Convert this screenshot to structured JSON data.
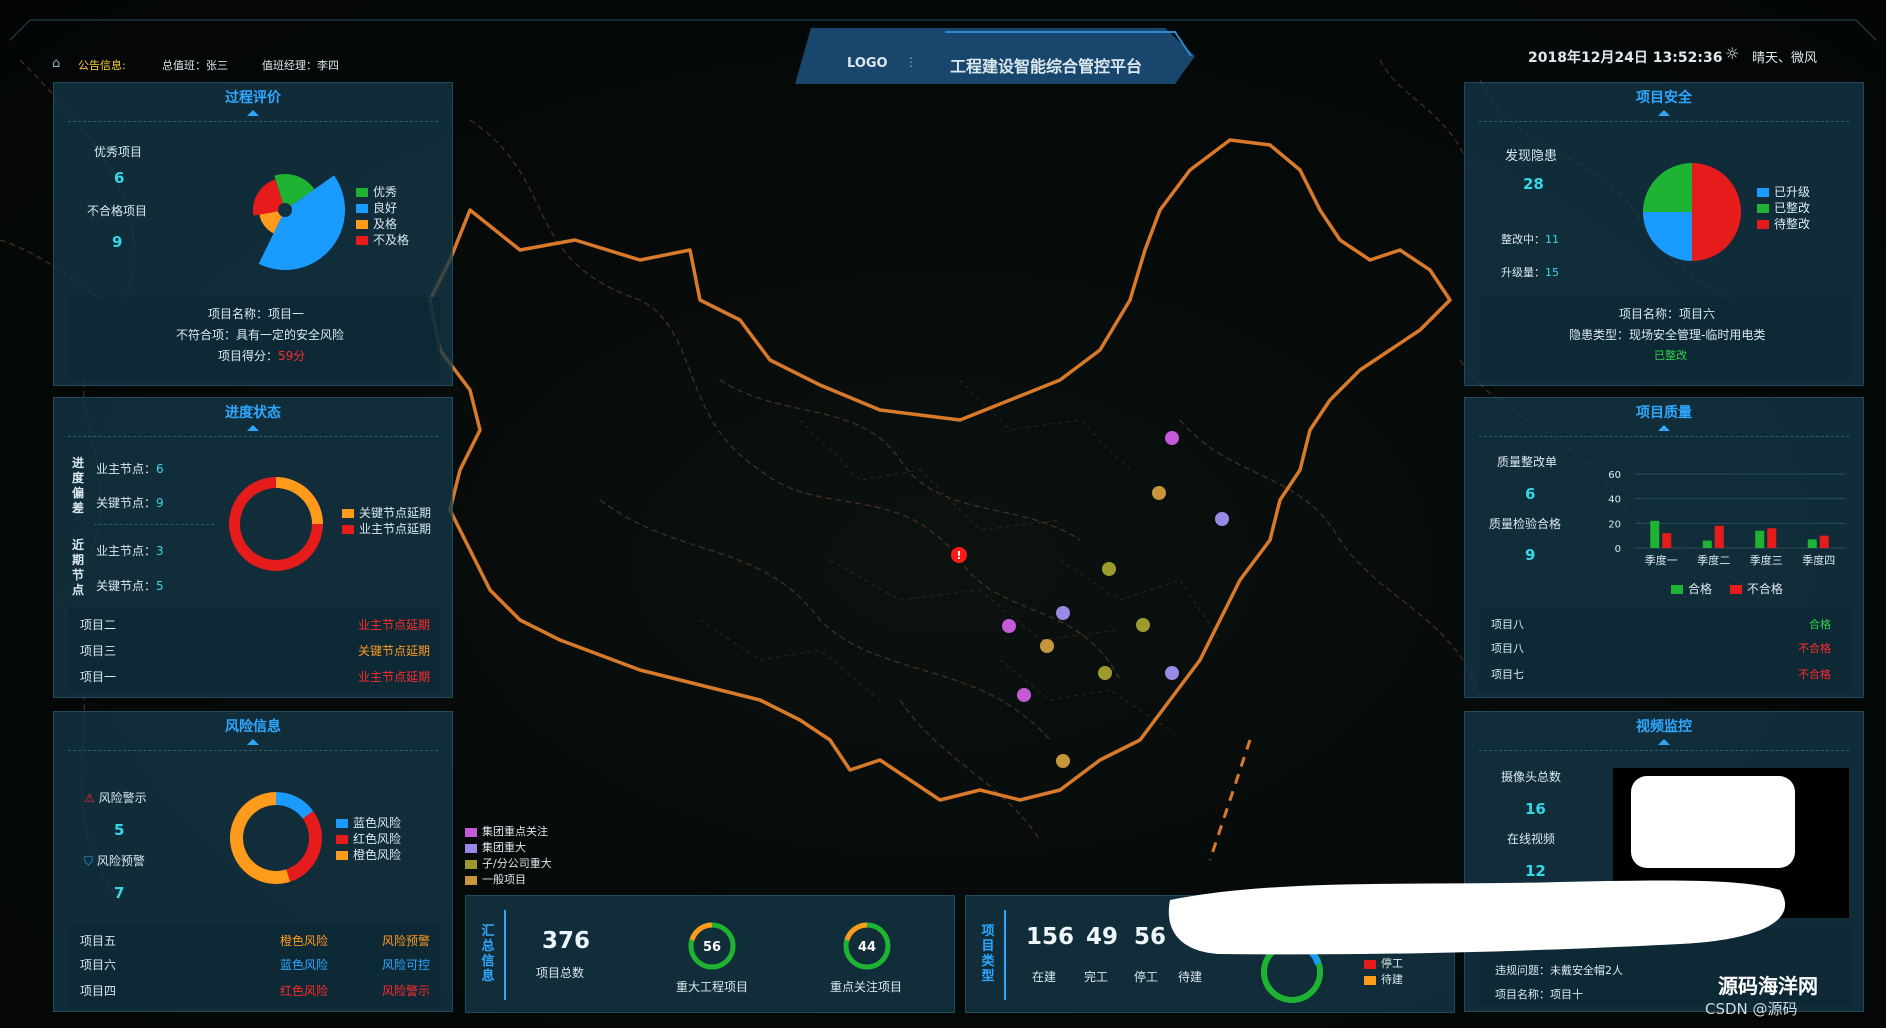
{
  "header": {
    "notice_label": "公告信息:",
    "chief_duty": "总值班：张三",
    "duty_manager": "值班经理：李四",
    "logo": "LOGO",
    "title": "工程建设智能综合管控平台",
    "datetime": "2018年12月24日 13:52:36",
    "weather": "晴天、微风"
  },
  "process_eval": {
    "title": "过程评价",
    "excellent_label": "优秀项目",
    "excellent_value": "6",
    "fail_label": "不合格项目",
    "fail_value": "9",
    "legend": [
      {
        "name": "优秀",
        "color": "#1eb332"
      },
      {
        "name": "良好",
        "color": "#1a9bff"
      },
      {
        "name": "及格",
        "color": "#ff9b1c"
      },
      {
        "name": "不及格",
        "color": "#e61c1c"
      }
    ],
    "project_name": "项目名称：项目一",
    "nonconform": "不符合项：具有一定的安全风险",
    "score_label": "项目得分：",
    "score_value": "59分"
  },
  "progress": {
    "title": "进度状态",
    "group1_label": "进度偏差",
    "group2_label": "近期节点",
    "g1_owner_label": "业主节点：",
    "g1_owner_value": "6",
    "g1_key_label": "关键节点：",
    "g1_key_value": "9",
    "g2_owner_label": "业主节点：",
    "g2_owner_value": "3",
    "g2_key_label": "关键节点：",
    "g2_key_value": "5",
    "legend": [
      {
        "name": "关键节点延期",
        "color": "#ff9b1c"
      },
      {
        "name": "业主节点延期",
        "color": "#e61c1c"
      }
    ],
    "rows": [
      {
        "name": "项目二",
        "status": "业主节点延期",
        "color": "#ff2a2a"
      },
      {
        "name": "项目三",
        "status": "关键节点延期",
        "color": "#ff9a1f"
      },
      {
        "name": "项目一",
        "status": "业主节点延期",
        "color": "#ff2a2a"
      }
    ]
  },
  "risk": {
    "title": "风险信息",
    "warning_label": "风险警示",
    "warning_value": "5",
    "alert_label": "风险预警",
    "alert_value": "7",
    "legend": [
      {
        "name": "蓝色风险",
        "color": "#1a9bff"
      },
      {
        "name": "红色风险",
        "color": "#e61c1c"
      },
      {
        "name": "橙色风险",
        "color": "#ff9b1c"
      }
    ],
    "rows": [
      {
        "name": "项目五",
        "level": "橙色风险",
        "level_color": "#ff9a1f",
        "type": "风险预警",
        "type_color": "#ff9a1f"
      },
      {
        "name": "项目六",
        "level": "蓝色风险",
        "level_color": "#2fa7ff",
        "type": "风险可控",
        "type_color": "#2fa7ff"
      },
      {
        "name": "项目四",
        "level": "红色风险",
        "level_color": "#ff2a2a",
        "type": "风险警示",
        "type_color": "#ff2a2a"
      }
    ]
  },
  "safety": {
    "title": "项目安全",
    "found_label": "发现隐患",
    "found_value": "28",
    "fixing_label": "整改中：",
    "fixing_value": "11",
    "upgrade_label": "升级量：",
    "upgrade_value": "15",
    "legend": [
      {
        "name": "已升级",
        "color": "#1a9bff"
      },
      {
        "name": "已整改",
        "color": "#1eb332"
      },
      {
        "name": "待整改",
        "color": "#e61c1c"
      }
    ],
    "project_name": "项目名称：项目六",
    "hazard_type": "隐患类型：现场安全管理-临时用电类",
    "status": "已整改"
  },
  "quality": {
    "title": "项目质量",
    "fix_label": "质量整改单",
    "fix_value": "6",
    "pass_label": "质量检验合格",
    "pass_value": "9",
    "rows": [
      {
        "name": "项目八",
        "status": "合格",
        "color": "#32d04a"
      },
      {
        "name": "项目八",
        "status": "不合格",
        "color": "#ff2a2a"
      },
      {
        "name": "项目七",
        "status": "不合格",
        "color": "#ff2a2a"
      }
    ]
  },
  "video": {
    "title": "视频监控",
    "cam_label": "摄像头总数",
    "cam_value": "16",
    "online_label": "在线视频",
    "online_value": "12",
    "violation": "违规问题：未戴安全帽2人",
    "project_name": "项目名称：项目十"
  },
  "map_legend": [
    {
      "name": "集团重点关注",
      "color": "#c45ad8"
    },
    {
      "name": "集团重大",
      "color": "#9a8ae8"
    },
    {
      "name": "子/分公司重大",
      "color": "#9c9a2a"
    },
    {
      "name": "一般项目",
      "color": "#c8963a"
    }
  ],
  "summary": {
    "title": "汇总信息",
    "total_value": "376",
    "total_label": "项目总数",
    "major_value": "56",
    "major_label": "重大工程项目",
    "focus_value": "44",
    "focus_label": "重点关注项目"
  },
  "ptype": {
    "title": "项目类型",
    "items": [
      {
        "value": "156",
        "label": "在建"
      },
      {
        "value": "49",
        "label": "完工"
      },
      {
        "value": "56",
        "label": "停工"
      },
      {
        "value": "",
        "label": "待建"
      }
    ],
    "legend": [
      {
        "name": "完工",
        "color": "#1eb332"
      },
      {
        "name": "停工",
        "color": "#e61c1c"
      },
      {
        "name": "待建",
        "color": "#ff9b1c"
      }
    ]
  },
  "watermark": "源码海洋网",
  "watermark2": "CSDN @源码 ",
  "chart_data": [
    {
      "type": "pie",
      "title": "过程评价",
      "categories": [
        "优秀",
        "良好",
        "及格",
        "不及格"
      ],
      "values": [
        20,
        42,
        15,
        23
      ]
    },
    {
      "type": "pie",
      "title": "进度状态",
      "categories": [
        "关键节点延期",
        "业主节点延期"
      ],
      "values": [
        25,
        75
      ]
    },
    {
      "type": "pie",
      "title": "风险信息",
      "categories": [
        "蓝色风险",
        "红色风险",
        "橙色风险"
      ],
      "values": [
        15,
        30,
        55
      ]
    },
    {
      "type": "pie",
      "title": "项目安全",
      "categories": [
        "已升级",
        "已整改",
        "待整改"
      ],
      "values": [
        25,
        25,
        50
      ]
    },
    {
      "type": "bar",
      "title": "项目质量",
      "categories": [
        "季度一",
        "季度二",
        "季度三",
        "季度四"
      ],
      "series": [
        {
          "name": "合格",
          "values": [
            22,
            6,
            14,
            7
          ],
          "color": "#1eb332"
        },
        {
          "name": "不合格",
          "values": [
            12,
            18,
            16,
            10
          ],
          "color": "#e61c1c"
        }
      ],
      "ylim": [
        0,
        60
      ],
      "yticks": [
        0,
        20,
        40,
        60
      ]
    }
  ]
}
